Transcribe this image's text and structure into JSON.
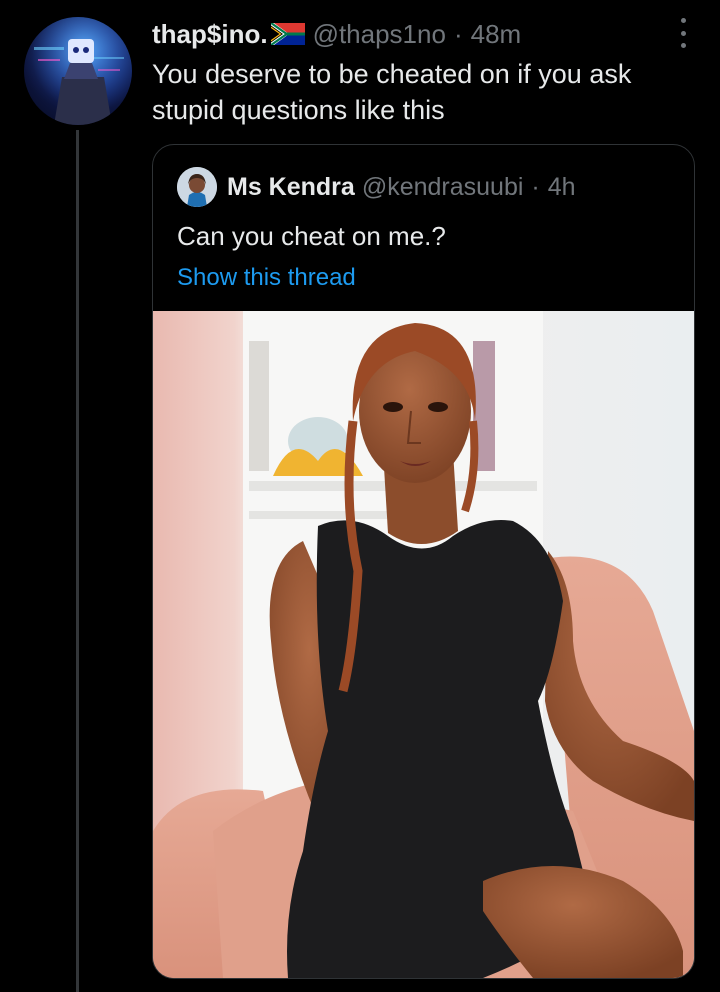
{
  "tweet": {
    "author": {
      "display_name": "thap$ino.",
      "flag_icon": "south-africa-flag-icon",
      "handle": "@thaps1no",
      "separator": "·",
      "time": "48m"
    },
    "more_icon": "more-vertical-icon",
    "text": "You deserve to be cheated on if you ask stupid questions like this",
    "quote": {
      "author": {
        "display_name": "Ms Kendra",
        "handle": "@kendrasuubi",
        "separator": "·",
        "time": "4h"
      },
      "text": "Can you cheat on me.?",
      "show_thread": "Show this thread",
      "link_color": "#1d9bf0"
    }
  },
  "colors": {
    "background": "#000000",
    "text": "#e7e9ea",
    "secondary": "#71767b",
    "border": "#2f3336"
  }
}
